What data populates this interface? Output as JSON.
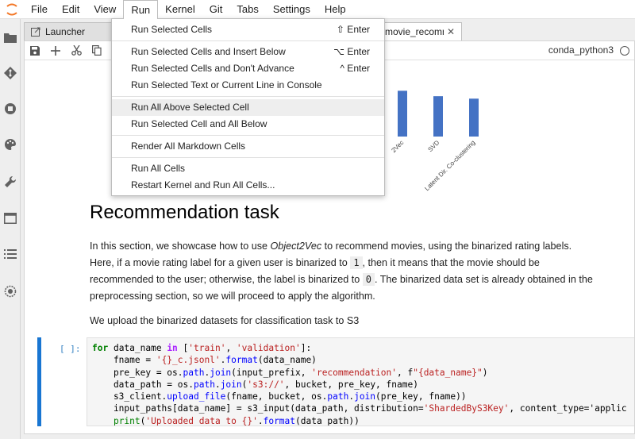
{
  "menubar": {
    "items": [
      "File",
      "Edit",
      "View",
      "Run",
      "Kernel",
      "Git",
      "Tabs",
      "Settings",
      "Help"
    ],
    "active": "Run"
  },
  "tabs": [
    {
      "label": "Launcher"
    },
    {
      "label": "movie_recomm"
    }
  ],
  "kernel": {
    "name": "conda_python3"
  },
  "chart_data": {
    "type": "bar",
    "categories": [
      "2Vec",
      "SVD",
      "Latent Dir. Co-clustering"
    ],
    "values": [
      0.93,
      0.82,
      0.77
    ],
    "color": "#4472c4"
  },
  "run_menu": {
    "groups": [
      [
        {
          "label": "Run Selected Cells",
          "shortcut": "⇧ Enter"
        }
      ],
      [
        {
          "label": "Run Selected Cells and Insert Below",
          "shortcut": "⌥ Enter"
        },
        {
          "label": "Run Selected Cells and Don't Advance",
          "shortcut": "^ Enter"
        },
        {
          "label": "Run Selected Text or Current Line in Console",
          "shortcut": ""
        }
      ],
      [
        {
          "label": "Run All Above Selected Cell",
          "shortcut": ""
        },
        {
          "label": "Run Selected Cell and All Below",
          "shortcut": ""
        }
      ],
      [
        {
          "label": "Render All Markdown Cells",
          "shortcut": ""
        }
      ],
      [
        {
          "label": "Run All Cells",
          "shortcut": ""
        },
        {
          "label": "Restart Kernel and Run All Cells...",
          "shortcut": ""
        }
      ]
    ],
    "hovered": "Run All Above Selected Cell"
  },
  "markdown": {
    "heading": "Recommendation task",
    "para1_a": "In this section, we showcase how to use ",
    "para1_em": "Object2Vec",
    "para1_b": " to recommend movies, using the binarized rating labels. Here, if a movie rating label for a given user is binarized to ",
    "code1": "1",
    "para1_c": ", then it means that the movie should be recommended to the user; otherwise, the label is binarized to ",
    "code0": "0",
    "para1_d": ". The binarized data set is already obtained in the preprocessing section, so we will proceed to apply the algorithm.",
    "para2": "We upload the binarized datasets for classification task to S3"
  },
  "code_cell": {
    "prompt": "[ ]:",
    "lines": [
      "for data_name in ['train', 'validation']:",
      "    fname = '{}_c.jsonl'.format(data_name)",
      "    pre_key = os.path.join(input_prefix, 'recommendation', f\"{data_name}\")",
      "    data_path = os.path.join('s3://', bucket, pre_key, fname)",
      "    s3_client.upload_file(fname, bucket, os.path.join(pre_key, fname))",
      "    input_paths[data_name] = s3_input(data_path, distribution='ShardedByS3Key', content_type='applic",
      "    print('Uploaded data to {}'.format(data_path))"
    ]
  }
}
